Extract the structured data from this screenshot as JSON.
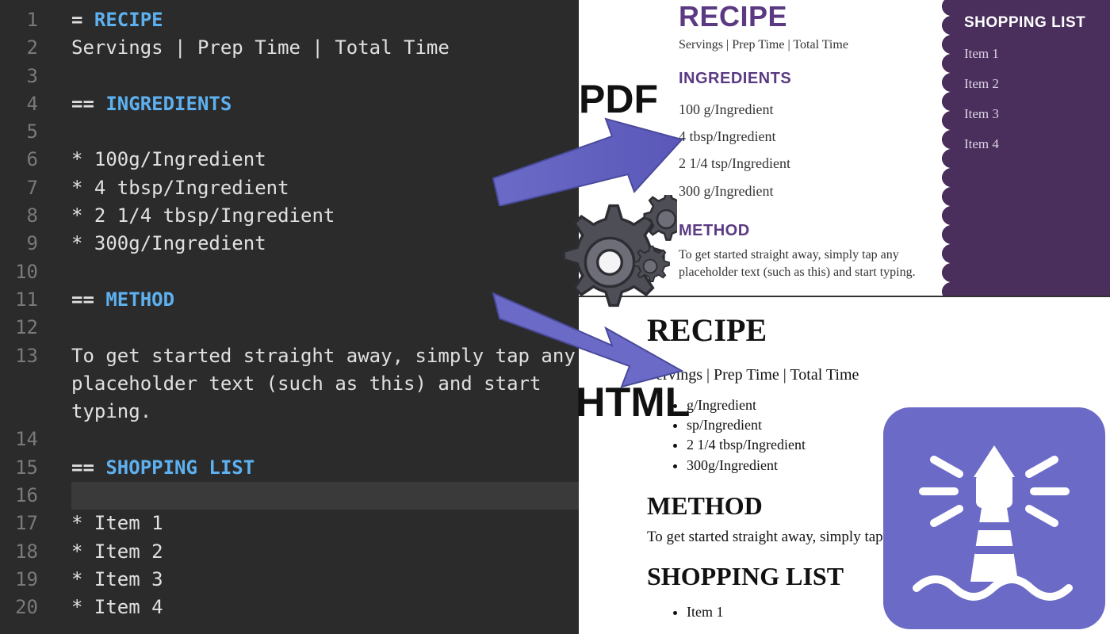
{
  "editor": {
    "lines": [
      {
        "n": 1,
        "segs": [
          [
            "= ",
            "eq"
          ],
          [
            "RECIPE",
            "h1"
          ]
        ]
      },
      {
        "n": 2,
        "segs": [
          [
            "Servings | Prep Time | Total Time",
            "txt"
          ]
        ]
      },
      {
        "n": 3,
        "segs": [
          [
            "",
            "txt"
          ]
        ]
      },
      {
        "n": 4,
        "segs": [
          [
            "== ",
            "eq"
          ],
          [
            "INGREDIENTS",
            "h2"
          ]
        ]
      },
      {
        "n": 5,
        "segs": [
          [
            "",
            "txt"
          ]
        ]
      },
      {
        "n": 6,
        "segs": [
          [
            "* ",
            "ast"
          ],
          [
            "100g/Ingredient",
            "txt"
          ]
        ]
      },
      {
        "n": 7,
        "segs": [
          [
            "* ",
            "ast"
          ],
          [
            "4 tbsp/Ingredient",
            "txt"
          ]
        ]
      },
      {
        "n": 8,
        "segs": [
          [
            "* ",
            "ast"
          ],
          [
            "2 1/4 tbsp/Ingredient",
            "txt"
          ]
        ]
      },
      {
        "n": 9,
        "segs": [
          [
            "* ",
            "ast"
          ],
          [
            "300g/Ingredient",
            "txt"
          ]
        ]
      },
      {
        "n": 10,
        "segs": [
          [
            "",
            "txt"
          ]
        ]
      },
      {
        "n": 11,
        "segs": [
          [
            "== ",
            "eq"
          ],
          [
            "METHOD",
            "h2"
          ]
        ]
      },
      {
        "n": 12,
        "segs": [
          [
            "",
            "txt"
          ]
        ]
      },
      {
        "n": 13,
        "segs": [
          [
            "To get started straight away, simply tap any placeholder text (such as this) and start typing.",
            "txt"
          ]
        ]
      },
      {
        "n": 14,
        "segs": [
          [
            "",
            "txt"
          ]
        ]
      },
      {
        "n": 15,
        "segs": [
          [
            "== ",
            "eq"
          ],
          [
            "SHOPPING LIST",
            "h2"
          ]
        ]
      },
      {
        "n": 16,
        "segs": [
          [
            "",
            "txt"
          ]
        ],
        "active": true
      },
      {
        "n": 17,
        "segs": [
          [
            "* ",
            "ast"
          ],
          [
            "Item 1",
            "txt"
          ]
        ]
      },
      {
        "n": 18,
        "segs": [
          [
            "* ",
            "ast"
          ],
          [
            "Item 2",
            "txt"
          ]
        ]
      },
      {
        "n": 19,
        "segs": [
          [
            "* ",
            "ast"
          ],
          [
            "Item 3",
            "txt"
          ]
        ]
      },
      {
        "n": 20,
        "segs": [
          [
            "* ",
            "ast"
          ],
          [
            "Item 4",
            "txt"
          ]
        ]
      }
    ]
  },
  "labels": {
    "pdf": "PDF",
    "html": "HTML"
  },
  "pdf": {
    "title": "RECIPE",
    "meta": "Servings | Prep Time | Total Time",
    "ing_title": "INGREDIENTS",
    "ingredients": [
      "100 g/Ingredient",
      "4 tbsp/Ingredient",
      "2 1/4 tsp/Ingredient",
      "300 g/Ingredient"
    ],
    "method_title": "METHOD",
    "method_body": "To get started straight away, simply tap any placeholder text (such as this) and start typing.",
    "side_title": "SHOPPING LIST",
    "side_items": [
      "Item 1",
      "Item 2",
      "Item 3",
      "Item 4"
    ]
  },
  "html": {
    "title": "RECIPE",
    "meta": "Servings | Prep Time | Total Time",
    "ingredients": [
      "g/Ingredient",
      "sp/Ingredient",
      "2 1/4 tbsp/Ingredient",
      "300g/Ingredient"
    ],
    "method_title": "METHOD",
    "method_body": "To get started straight away, simply tap and start typing.",
    "shop_title": "SHOPPING LIST",
    "shop_first": "Item 1"
  }
}
